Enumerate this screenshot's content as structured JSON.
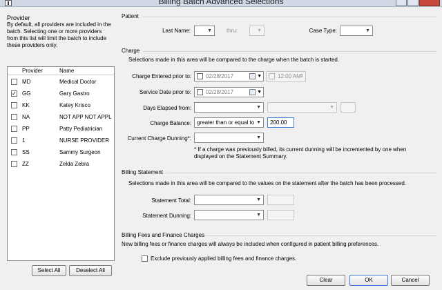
{
  "window": {
    "title": "Billing Batch Advanced Selections"
  },
  "provider": {
    "heading": "Provider",
    "description": "By default, all providers are included in the batch. Selecting one or more providers from this list will limit the batch to include these providers only.",
    "columns": {
      "provider": "Provider",
      "name": "Name"
    },
    "rows": [
      {
        "code": "MD",
        "name": "Medical Doctor",
        "checked": false
      },
      {
        "code": "GG",
        "name": "Gary Gastro",
        "checked": true
      },
      {
        "code": "KK",
        "name": "Katey Krisco",
        "checked": false
      },
      {
        "code": "NA",
        "name": "NOT APP NOT APPL",
        "checked": false
      },
      {
        "code": "PP",
        "name": "Patty Pediatrician",
        "checked": false
      },
      {
        "code": "1",
        "name": "NURSE PROVIDER",
        "checked": false
      },
      {
        "code": "SS",
        "name": "Sammy Surgeon",
        "checked": false
      },
      {
        "code": "ZZ",
        "name": "Zelda Zebra",
        "checked": false
      }
    ],
    "select_all": "Select All",
    "deselect_all": "Deselect All"
  },
  "patient": {
    "title": "Patient",
    "last_name_label": "Last Name:",
    "thru_label": "thru:",
    "case_type_label": "Case Type:"
  },
  "charge": {
    "title": "Charge",
    "info": "Selections made in this area will be compared to the charge when the batch is started.",
    "entered_label": "Charge Entered prior to:",
    "entered_date": "02/28/2017",
    "entered_time": "12:00 AM",
    "service_label": "Service Date prior to:",
    "service_date": "02/28/2017",
    "days_elapsed_label": "Days Elapsed from:",
    "balance_label": "Charge Balance:",
    "balance_operator": "greater than or equal to",
    "balance_value": "200.00",
    "dunning_label": "Current Charge Dunning*:",
    "dunning_note": "* If a charge was previously billed, its current dunning will be incremented by one when displayed on the Statement Summary."
  },
  "billing_statement": {
    "title": "Billing Statement",
    "info": "Selections made in this area will be compared to the values on the statement after the batch has been processed.",
    "total_label": "Statement Total:",
    "dunning_label": "Statement Dunning:"
  },
  "fees": {
    "title": "Billing Fees and Finance Charges",
    "info": "New billing fees or finance charges will always be included when configured in patient billing preferences.",
    "exclude_label": "Exclude previously applied billing fees and finance charges."
  },
  "buttons": {
    "clear": "Clear",
    "ok": "OK",
    "cancel": "Cancel"
  }
}
